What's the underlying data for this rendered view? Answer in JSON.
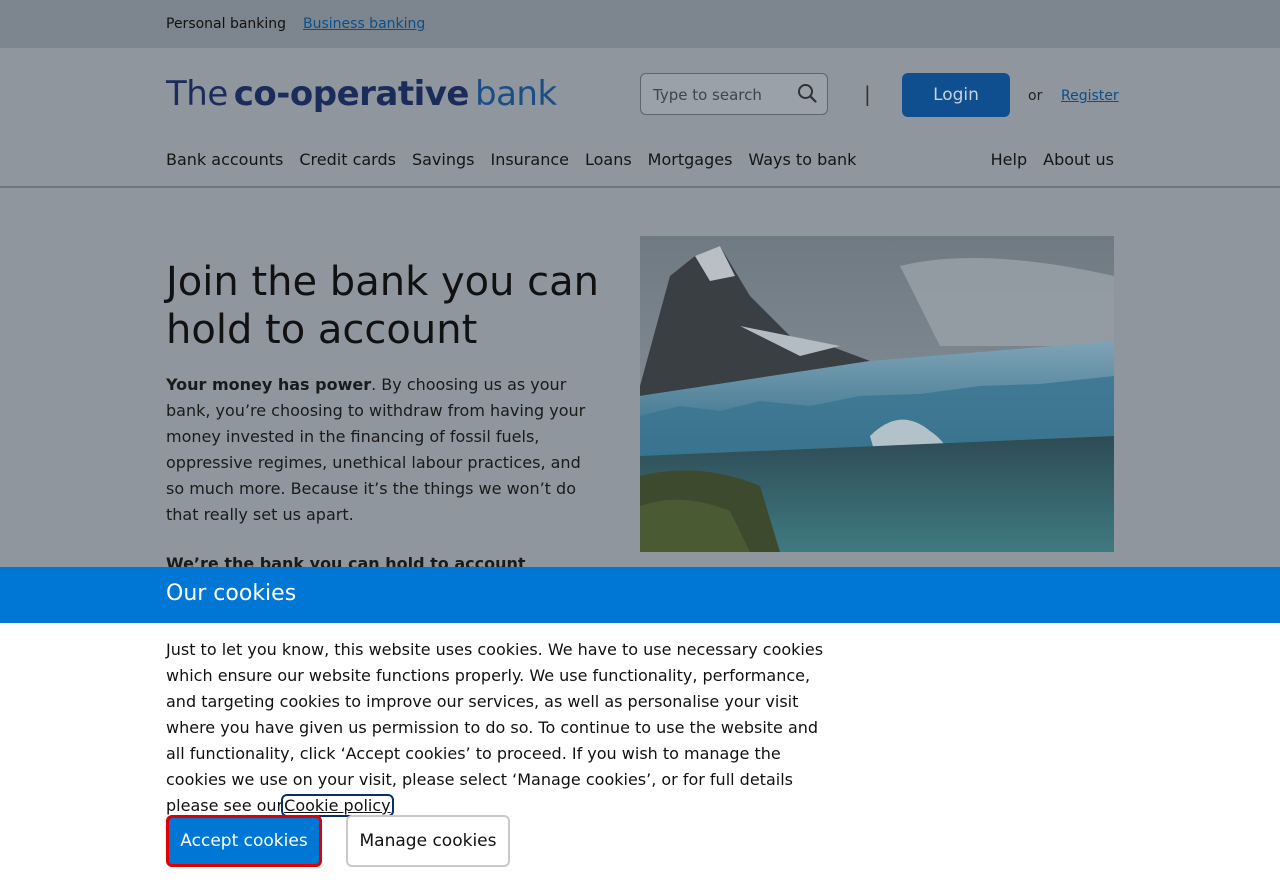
{
  "utility": {
    "personal": "Personal banking",
    "business": "Business banking"
  },
  "header": {
    "logo": {
      "the": "The",
      "coop": "co-operative",
      "bank": "bank"
    },
    "search_placeholder": "Type to search",
    "divider": "|",
    "login": "Login",
    "or": "or",
    "register": "Register"
  },
  "nav": {
    "left": [
      "Bank accounts",
      "Credit cards",
      "Savings",
      "Insurance",
      "Loans",
      "Mortgages",
      "Ways to bank"
    ],
    "right": [
      "Help",
      "About us"
    ]
  },
  "hero": {
    "title": "Join the bank you can hold to account",
    "body_lead": "Your money has power",
    "body_rest": ". By choosing us as your bank, you’re choosing to withdraw from having your money invested in the financing of fossil fuels, oppressive regimes, unethical labour practices, and so much more. Because it’s the things we won’t do that really set us apart.",
    "strap": "We’re the bank you can hold to account"
  },
  "cookie": {
    "title": "Our cookies",
    "text": "Just to let you know, this website uses cookies. We have to use necessary cookies which ensure our website functions properly. We use functionality, performance, and targeting cookies to improve our services, as well as personalise your visit where you have given us permission to do so. To continue to use the website and all functionality, click ‘Accept cookies’ to proceed. If you wish to manage the cookies we use on your visit, please select ‘Manage cookies’, or for full details please see our",
    "policy_link": "Cookie policy",
    "accept": "Accept cookies",
    "manage": "Manage cookies"
  },
  "colors": {
    "brand_blue": "#0077d4",
    "navy": "#1b2c5b",
    "focus_red": "#e10000"
  },
  "icons": {
    "search": "search-icon"
  }
}
